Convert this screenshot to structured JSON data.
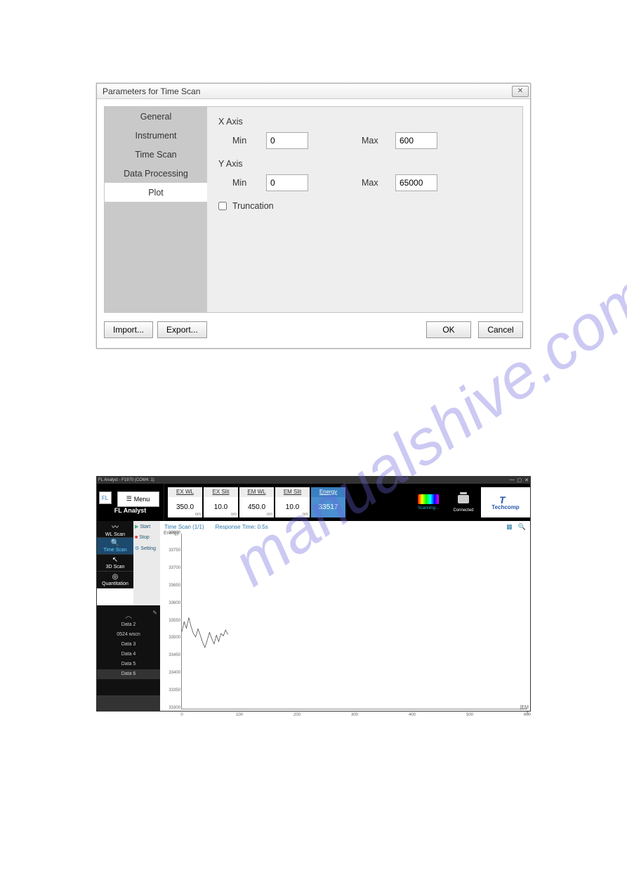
{
  "dialog": {
    "title": "Parameters for Time Scan",
    "tabs": [
      "General",
      "Instrument",
      "Time Scan",
      "Data Processing",
      "Plot"
    ],
    "selected_tab": 4,
    "xaxis": {
      "label": "X Axis",
      "min_label": "Min",
      "min": "0",
      "max_label": "Max",
      "max": "600"
    },
    "yaxis": {
      "label": "Y Axis",
      "min_label": "Min",
      "min": "0",
      "max_label": "Max",
      "max": "65000"
    },
    "truncation_label": "Truncation",
    "truncation_checked": false,
    "buttons": {
      "import": "Import...",
      "export": "Export...",
      "ok": "OK",
      "cancel": "Cancel"
    }
  },
  "app": {
    "title": "FL Analyst - F1970 (COM4: 1)",
    "logo": "FL",
    "app_name": "FL Analyst",
    "menu_label": "Menu",
    "params": [
      {
        "hd": "EX WL",
        "val": "350.0",
        "unit": "nm"
      },
      {
        "hd": "EX Slit",
        "val": "10.0",
        "unit": "nm"
      },
      {
        "hd": "EM WL",
        "val": "450.0",
        "unit": "nm"
      },
      {
        "hd": "EM Slit",
        "val": "10.0",
        "unit": "nm"
      },
      {
        "hd": "Energy",
        "val": "33517",
        "unit": ""
      }
    ],
    "scanning": "Scanning...",
    "connected": "Connected",
    "brand": "Techcomp",
    "side": [
      {
        "label": "WL Scan"
      },
      {
        "label": "Time Scan"
      },
      {
        "label": "3D Scan"
      },
      {
        "label": "Quantitation"
      }
    ],
    "ctrl": {
      "start": "Start",
      "stop": "Stop",
      "setting": "Setting"
    },
    "data_items": [
      "Data 2",
      "0524 wscn",
      "Data 3",
      "Data 4",
      "Data 5",
      "Data 6"
    ],
    "chart_title": "Time Scan  (1/1)",
    "response": "Response Time: 0.5s",
    "ylabel": "Energy",
    "xlabel": "|EM",
    "xlabel2": "s"
  },
  "chart_data": {
    "type": "line",
    "title": "Time Scan (1/1)  Energy vs time",
    "xlabel": "s",
    "ylabel": "Energy",
    "xlim": [
      0,
      600
    ],
    "ylim": [
      33300,
      33800
    ],
    "yticks": [
      33300,
      33350,
      33400,
      33450,
      33500,
      33550,
      33600,
      33650,
      33700,
      33750,
      33800
    ],
    "xticks": [
      0,
      100,
      200,
      300,
      400,
      500,
      600
    ],
    "x": [
      0,
      4,
      8,
      12,
      16,
      20,
      24,
      28,
      32,
      36,
      40,
      44,
      48,
      52,
      56,
      60,
      64,
      68,
      72,
      76,
      80
    ],
    "values": [
      33520,
      33548,
      33530,
      33560,
      33535,
      33515,
      33505,
      33528,
      33510,
      33490,
      33475,
      33495,
      33518,
      33500,
      33485,
      33510,
      33492,
      33515,
      33508,
      33525,
      33512
    ]
  },
  "watermark": "manualshive.com"
}
